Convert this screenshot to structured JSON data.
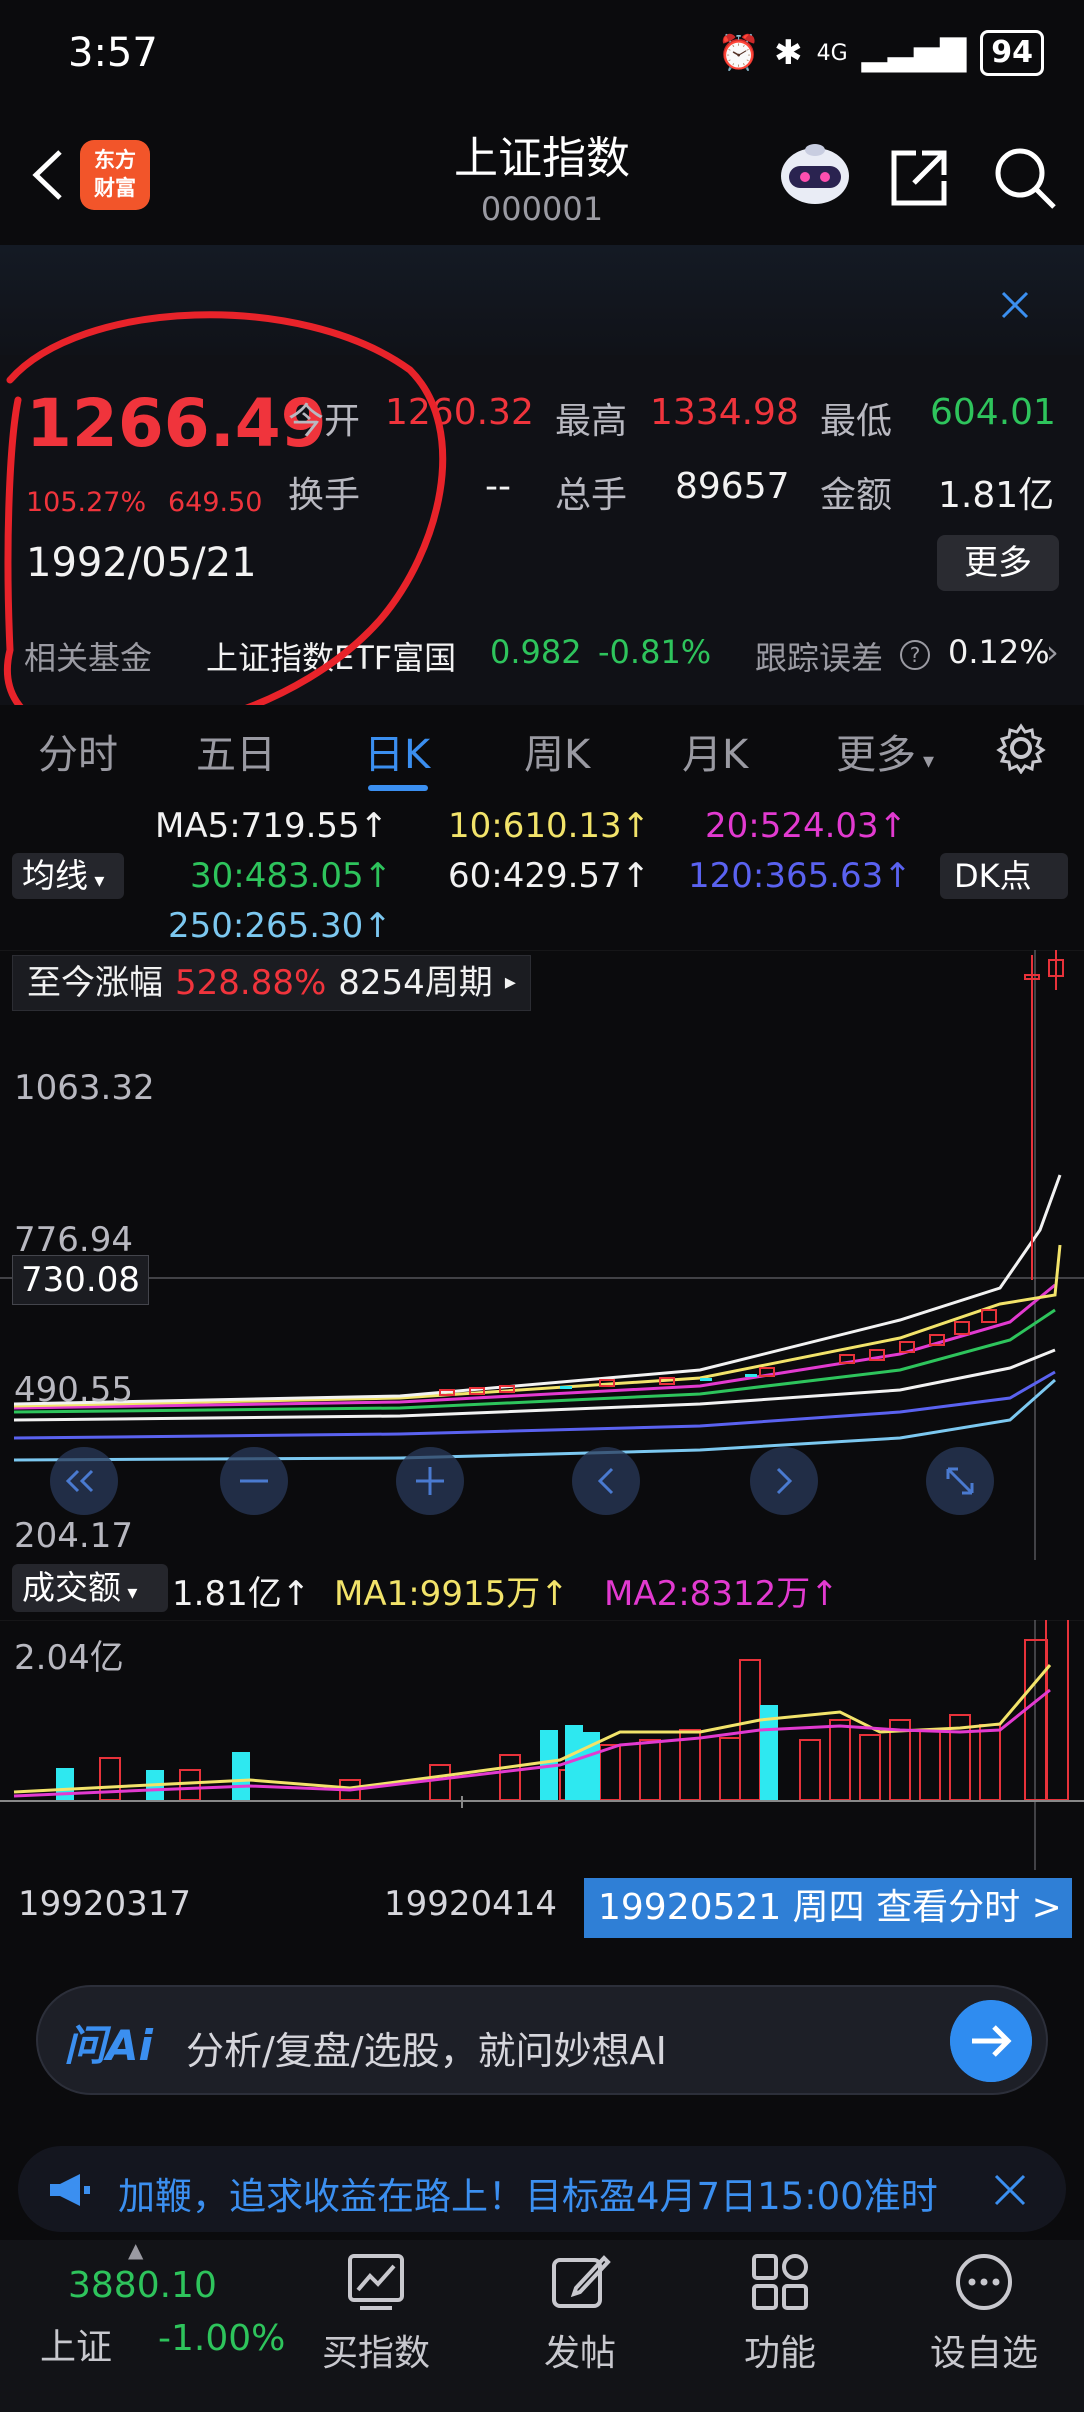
{
  "status": {
    "time": "3:57",
    "battery": "94",
    "network": "4G"
  },
  "header": {
    "title": "上证指数",
    "code": "000001",
    "logo_text_1": "东方",
    "logo_text_2": "财富"
  },
  "quote": {
    "price": "1266.49",
    "change_pct": "105.27%",
    "change_abs": "649.50",
    "date": "1992/05/21",
    "open_label": "今开",
    "open": "1260.32",
    "high_label": "最高",
    "high": "1334.98",
    "low_label": "最低",
    "low": "604.01",
    "turnover_label": "换手",
    "turnover": "--",
    "volume_label": "总手",
    "volume": "89657",
    "amount_label": "金额",
    "amount": "1.81亿",
    "more": "更多"
  },
  "fund": {
    "label": "相关基金",
    "name": "上证指数ETF富国",
    "price": "0.982",
    "change": "-0.81%",
    "error_label": "跟踪误差",
    "error": "0.12%"
  },
  "tabs": [
    {
      "label": "分时"
    },
    {
      "label": "五日"
    },
    {
      "label": "日K"
    },
    {
      "label": "周K"
    },
    {
      "label": "月K"
    },
    {
      "label": "更多"
    }
  ],
  "ma": {
    "button": "均线",
    "dk": "DK点",
    "ma5": "MA5:719.55↑",
    "ma10": "10:610.13↑",
    "ma20": "20:524.03↑",
    "ma30": "30:483.05↑",
    "ma60": "60:429.57↑",
    "ma120": "120:365.63↑",
    "ma250": "250:265.30↑",
    "colors": {
      "ma5": "#f2f2f2",
      "ma10": "#f2e36a",
      "ma20": "#e23ad0",
      "ma30": "#2ec45c",
      "ma60": "#f2f2f2",
      "ma120": "#5a62f0",
      "ma250": "#7cc8f0"
    }
  },
  "chart": {
    "range_label": "至今涨幅",
    "range_pct": "528.88%",
    "range_periods": "8254周期",
    "y_labels": [
      "1063.32",
      "776.94",
      "490.55",
      "204.17"
    ],
    "crosshair": "730.08"
  },
  "volume": {
    "button": "成交额",
    "value": "1.81亿↑",
    "ma1": "MA1:9915万↑",
    "ma2": "MA2:8312万↑",
    "max_label": "2.04亿"
  },
  "dates": {
    "start": "19920317",
    "mid": "19920414",
    "selected": "19920521 周四 查看分时 >"
  },
  "ai": {
    "logo": "问Ai",
    "placeholder": "分析/复盘/选股，就问妙想AI"
  },
  "notice": {
    "text": "加鞭，追求收益在路上！目标盈4月7日15:00准时"
  },
  "nav": {
    "index_value": "3880.10",
    "index_name": "上证",
    "index_change": "-1.00%",
    "items": [
      {
        "label": "买指数"
      },
      {
        "label": "发帖"
      },
      {
        "label": "功能"
      },
      {
        "label": "设自选"
      }
    ]
  }
}
